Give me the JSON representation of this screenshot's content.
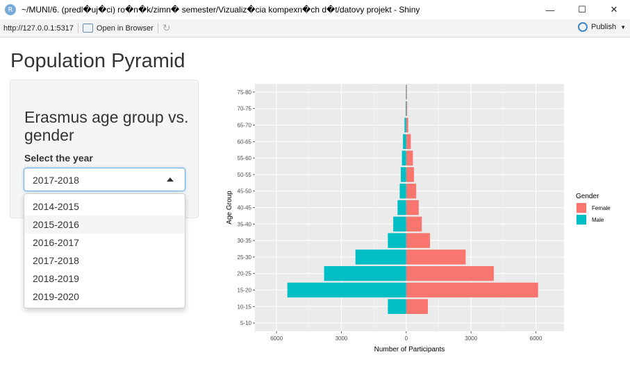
{
  "window": {
    "title": "~/MUNI/6. (predl�uj�ci) ro�n�k/zimn� semester/Vizualiz�cia kompexn�ch d�t/datovy projekt - Shiny",
    "app_icon": "R"
  },
  "toolbar": {
    "url": "http://127.0.0.1:5317",
    "open_in_browser": "Open in Browser",
    "publish": "Publish"
  },
  "page": {
    "title": "Population Pyramid"
  },
  "sidebar": {
    "heading": "Erasmus age group vs. gender",
    "select_label": "Select the year",
    "selected_value": "2017-2018",
    "options": [
      "2014-2015",
      "2015-2016",
      "2016-2017",
      "2017-2018",
      "2018-2019",
      "2019-2020"
    ]
  },
  "chart_data": {
    "type": "bar",
    "orientation": "horizontal",
    "xlabel": "Number of Participants",
    "ylabel": "Age Group",
    "legend_title": "Gender",
    "legend_position": "right",
    "grid": true,
    "xlim": [
      -7000,
      7300
    ],
    "x_ticks": [
      -6000,
      -3000,
      0,
      3000,
      6000
    ],
    "x_tick_labels": [
      "6000",
      "3000",
      "0",
      "3000",
      "6000"
    ],
    "categories": [
      "5-10",
      "10-15",
      "15-20",
      "20-25",
      "25-30",
      "30-35",
      "35-40",
      "40-45",
      "45-50",
      "50-55",
      "55-60",
      "60-65",
      "65-70",
      "70-75",
      "75-80"
    ],
    "series": [
      {
        "name": "Female",
        "color": "#F8766D",
        "values": [
          0,
          1000,
          6100,
          4050,
          2750,
          1100,
          720,
          580,
          460,
          360,
          310,
          210,
          90,
          45,
          35
        ]
      },
      {
        "name": "Male",
        "color": "#00BFC4",
        "values": [
          0,
          850,
          5500,
          3800,
          2350,
          850,
          600,
          400,
          300,
          250,
          200,
          150,
          80,
          30,
          20
        ]
      }
    ]
  }
}
